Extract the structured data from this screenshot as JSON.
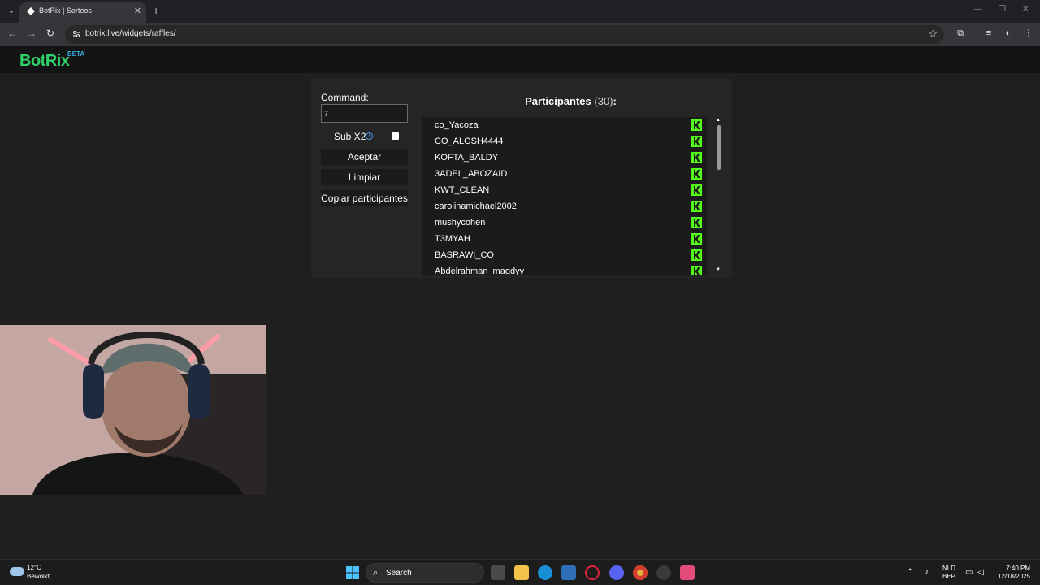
{
  "browser": {
    "tab_title": "BotRix | Sorteos",
    "url": "botrix.live/widgets/raffles/"
  },
  "header": {
    "logo": "BotRix",
    "beta": "BETA"
  },
  "form": {
    "command_label": "Command:",
    "command_value": "7",
    "sub_label": "Sub X2",
    "sub_checked": false,
    "accept_label": "Aceptar",
    "clear_label": "Limpiar",
    "copy_label": "Copiar participantes"
  },
  "participants": {
    "title": "Participantes",
    "count": "(30)",
    "colon": ":",
    "rows": [
      "co_Yacoza",
      "CO_ALOSH4444",
      "KOFTA_BALDY",
      "3ADEL_ABOZAID",
      "KWT_CLEAN",
      "carolinamichael2002",
      "mushycohen",
      "T3MYAH",
      "BASRAWI_CO",
      "Abdelrahman_magdyy"
    ],
    "platform_icon": "kick-icon",
    "accent_color": "#53fc18"
  },
  "taskbar": {
    "temperature": "12°C",
    "weather": "Bewolkt",
    "search": "Search",
    "lang_1": "NLD",
    "lang_2": "BEP",
    "time": "7:40 PM",
    "date": "12/18/2025"
  }
}
